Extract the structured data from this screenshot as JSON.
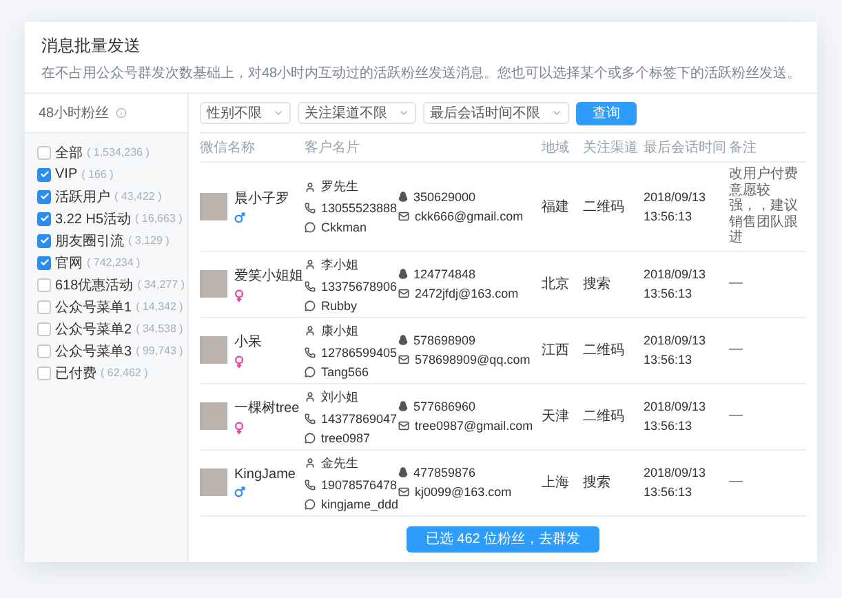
{
  "header": {
    "title": "消息批量发送",
    "description": "在不占用公众号群发次数基础上，对48小时内互动过的活跃粉丝发送消息。您也可以选择某个或多个标签下的活跃粉丝发送。"
  },
  "sidebar": {
    "title": "48小时粉丝",
    "items": [
      {
        "label": "全部",
        "count": "( 1,534,236 )",
        "checked": false
      },
      {
        "label": "VIP",
        "count": "( 166 )",
        "checked": true
      },
      {
        "label": "活跃用户",
        "count": "( 43,422 )",
        "checked": true
      },
      {
        "label": "3.22 H5活动",
        "count": "( 16,663 )",
        "checked": true
      },
      {
        "label": "朋友圈引流",
        "count": "( 3,129 )",
        "checked": true
      },
      {
        "label": "官网",
        "count": "( 742,234 )",
        "checked": true
      },
      {
        "label": "618优惠活动",
        "count": "( 34,277 )",
        "checked": false
      },
      {
        "label": "公众号菜单1",
        "count": "( 14,342 )",
        "checked": false
      },
      {
        "label": "公众号菜单2",
        "count": "( 34,538 )",
        "checked": false
      },
      {
        "label": "公众号菜单3",
        "count": "( 99,743 )",
        "checked": false
      },
      {
        "label": "已付费",
        "count": "( 62,462 )",
        "checked": false
      }
    ]
  },
  "filters": [
    {
      "value": "性别不限"
    },
    {
      "value": "关注渠道不限"
    },
    {
      "value": "最后会话时间不限"
    }
  ],
  "query_button": "查询",
  "table": {
    "columns": [
      "微信名称",
      "客户名片",
      "",
      "地域",
      "关注渠道",
      "最后会话时间",
      "备注"
    ],
    "rows": [
      {
        "name": "晨小子罗",
        "male": true,
        "contact": "罗先生",
        "phone": "13055523888",
        "wechat": "Ckkman",
        "qq": "350629000",
        "email": "ckk666@gmail.com",
        "region": "福建",
        "channel": "二维码",
        "date": "2018/09/13",
        "time": "13:56:13",
        "note": "改用户付费意愿较强，，建议销售团队跟进"
      },
      {
        "name": "爱笑小姐姐",
        "male": false,
        "contact": "李小姐",
        "phone": "13375678906",
        "wechat": "Rubby",
        "qq": "124774848",
        "email": "2472jfdj@163.com",
        "region": "北京",
        "channel": "搜索",
        "date": "2018/09/13",
        "time": "13:56:13",
        "note": "—"
      },
      {
        "name": "小呆",
        "male": false,
        "contact": "康小姐",
        "phone": "12786599405",
        "wechat": "Tang566",
        "qq": "578698909",
        "email": "578698909@qq.com",
        "region": "江西",
        "channel": "二维码",
        "date": "2018/09/13",
        "time": "13:56:13",
        "note": "—"
      },
      {
        "name": "一棵树tree",
        "male": false,
        "contact": "刘小姐",
        "phone": "14377869047",
        "wechat": "tree0987",
        "qq": "577686960",
        "email": "tree0987@gmail.com",
        "region": "天津",
        "channel": "二维码",
        "date": "2018/09/13",
        "time": "13:56:13",
        "note": "—"
      },
      {
        "name": "KingJame",
        "male": true,
        "contact": "金先生",
        "phone": "19078576478",
        "wechat": "kingjame_ddd",
        "qq": "477859876",
        "email": "kj0099@163.com",
        "region": "上海",
        "channel": "搜索",
        "date": "2018/09/13",
        "time": "13:56:13",
        "note": "—"
      }
    ]
  },
  "send_button": "已选 462 位粉丝，去群发"
}
